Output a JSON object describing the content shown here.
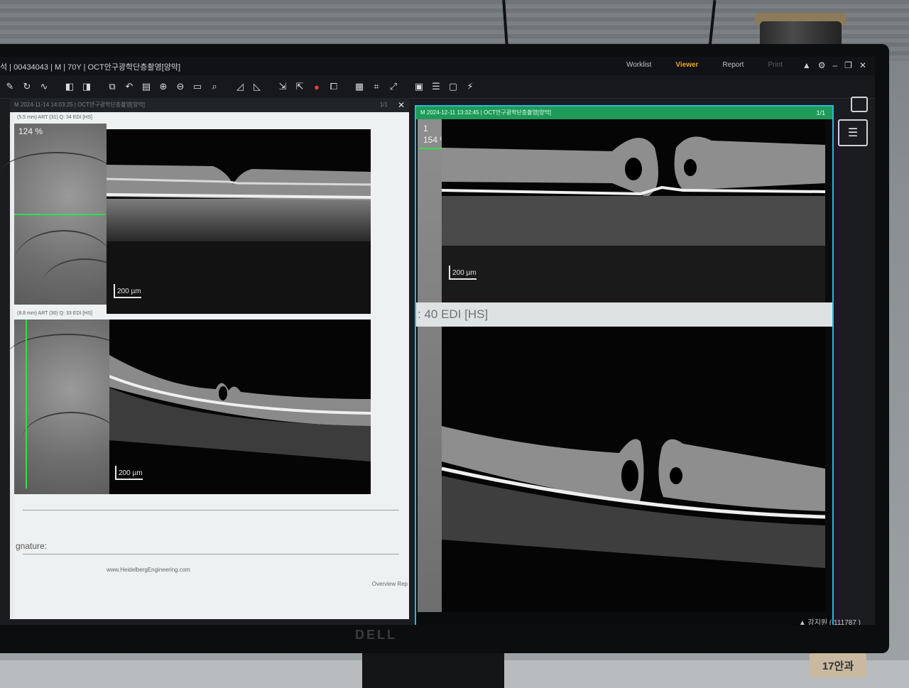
{
  "window": {
    "title": "석 | 00434043 | M | 70Y | OCT안구광학단층촬영[양막]",
    "nav": [
      "Worklist",
      "Viewer",
      "Report",
      "Print"
    ],
    "active_nav": "Viewer"
  },
  "toolbar": {
    "icons": [
      "pen-icon",
      "rotate-icon",
      "wave-icon",
      "prev-icon",
      "next-icon",
      "compare-icon",
      "undo-icon",
      "page-icon",
      "zoom-in-icon",
      "zoom-out-icon",
      "fit-icon",
      "magnify-icon",
      "flip-icon",
      "mirror-icon",
      "export-icon",
      "import-icon",
      "color-icon",
      "copy-icon",
      "grid-icon",
      "crop-icon",
      "expand-icon",
      "save-icon",
      "list-icon",
      "monitor-icon",
      "link-icon"
    ]
  },
  "left_pane": {
    "header": "M  2024-11-14 14:03:25 | OCT안구광학단층촬영[양막]",
    "page": "1/1",
    "close": "✕",
    "scan1": {
      "header": "(5.5 mm) ART (31) Q: 34 EDI [HS]",
      "zoom": "124 %",
      "scale": "200 µm"
    },
    "scan2": {
      "header": "(8.8 mm) ART (30) Q: 33 EDI [HS]",
      "scale": "200 µm"
    },
    "signature_label": "gnature:",
    "footer_url": "www.HeidelbergEngineering.com",
    "footer_right": "Overview Rep"
  },
  "right_pane": {
    "header": "M  2024-12-11 13:32:45 | OCT안구광학단층촬영[양막]",
    "page": "1/1",
    "scan1": {
      "index": "1",
      "zoom": "154 %",
      "scale": "200 µm"
    },
    "band_text": ": 40 EDI [HS]"
  },
  "status": {
    "user": "▲ 강지원 ( 111787 )"
  },
  "bezel": {
    "brand": "DELL",
    "sticker": "17안과"
  },
  "colors": {
    "green_header": "#1f9a59",
    "selection_border": "#27b8e0",
    "active_nav": "#f0a030",
    "scan_line": "#2ee14a"
  }
}
